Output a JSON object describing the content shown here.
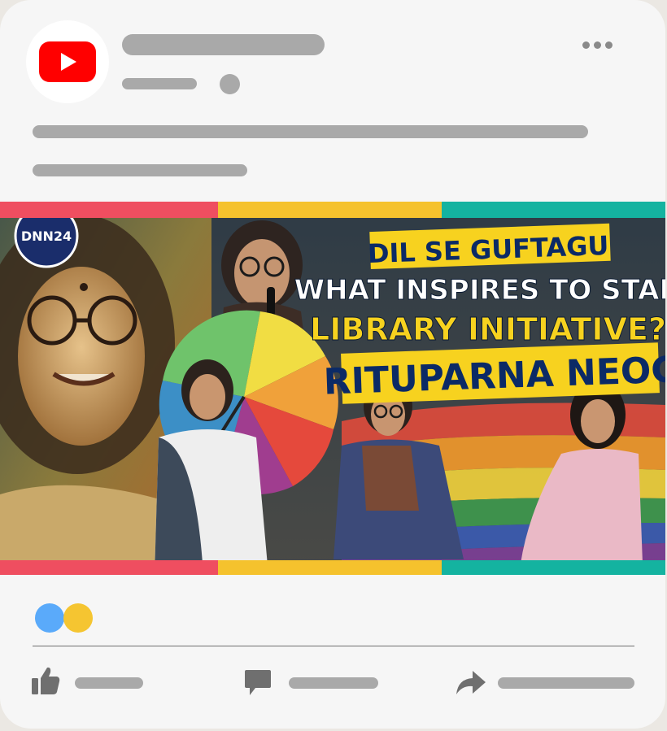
{
  "post": {
    "source_icon": "youtube-icon",
    "menu_icon": "more-horizontal-icon"
  },
  "thumbnail": {
    "channel_logo": "DNN24",
    "title_line1": "DIL SE GUFTAGU",
    "title_line2": "WHAT INSPIRES TO START",
    "title_line3": "LIBRARY INITIATIVE?",
    "title_line4": "RITUPARNA NEOG"
  },
  "reactions": {
    "colors": [
      "#5aaafa",
      "#f5c531"
    ]
  },
  "actions": [
    {
      "icon": "thumbs-up-icon"
    },
    {
      "icon": "comment-icon"
    },
    {
      "icon": "share-arrow-icon"
    }
  ],
  "colors": {
    "youtube_red": "#ff0000",
    "bar_red": "#ef4e60",
    "bar_yellow": "#f5c22d",
    "bar_teal": "#14b3a0",
    "title_yellow": "#f7d21f",
    "title_navy": "#0b2a66"
  }
}
